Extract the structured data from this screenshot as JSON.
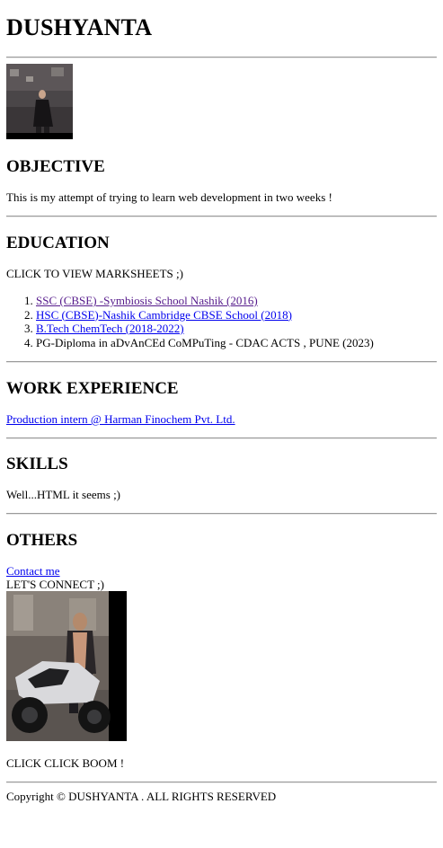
{
  "header": {
    "title": "DUSHYANTA"
  },
  "profile_photo": {
    "alt": "profile photo"
  },
  "objective": {
    "heading": "OBJECTIVE",
    "text": "This is my attempt of trying to learn web development in two weeks !"
  },
  "education": {
    "heading": "EDUCATION",
    "intro": "CLICK TO VIEW MARKSHEETS ;)",
    "items": [
      {
        "label": "SSC (CBSE) -Symbiosis School Nashik (2016)"
      },
      {
        "label": "HSC (CBSE)-Nashik Cambridge CBSE School (2018)"
      },
      {
        "label": "B.Tech ChemTech (2018-2022)"
      },
      {
        "label": "PG-Diploma in aDvAnCEd CoMPuTing - CDAC ACTS , PUNE (2023)"
      }
    ]
  },
  "work": {
    "heading": "WORK EXPERIENCE",
    "link": "Production intern @ Harman Finochem Pvt. Ltd."
  },
  "skills": {
    "heading": "SKILLS",
    "text": "Well...HTML it seems ;)"
  },
  "others": {
    "heading": "OTHERS",
    "contact_link": "Contact me",
    "connect_text": "LET'S CONNECT ;)",
    "caption": "CLICK CLICK BOOM !"
  },
  "footer": {
    "copyright": "Copyright © DUSHYANTA . ALL RIGHTS RESERVED"
  },
  "colors": {
    "link": "#0000ee",
    "visited_link": "#551a8b",
    "rule": "#9a9a9a"
  }
}
